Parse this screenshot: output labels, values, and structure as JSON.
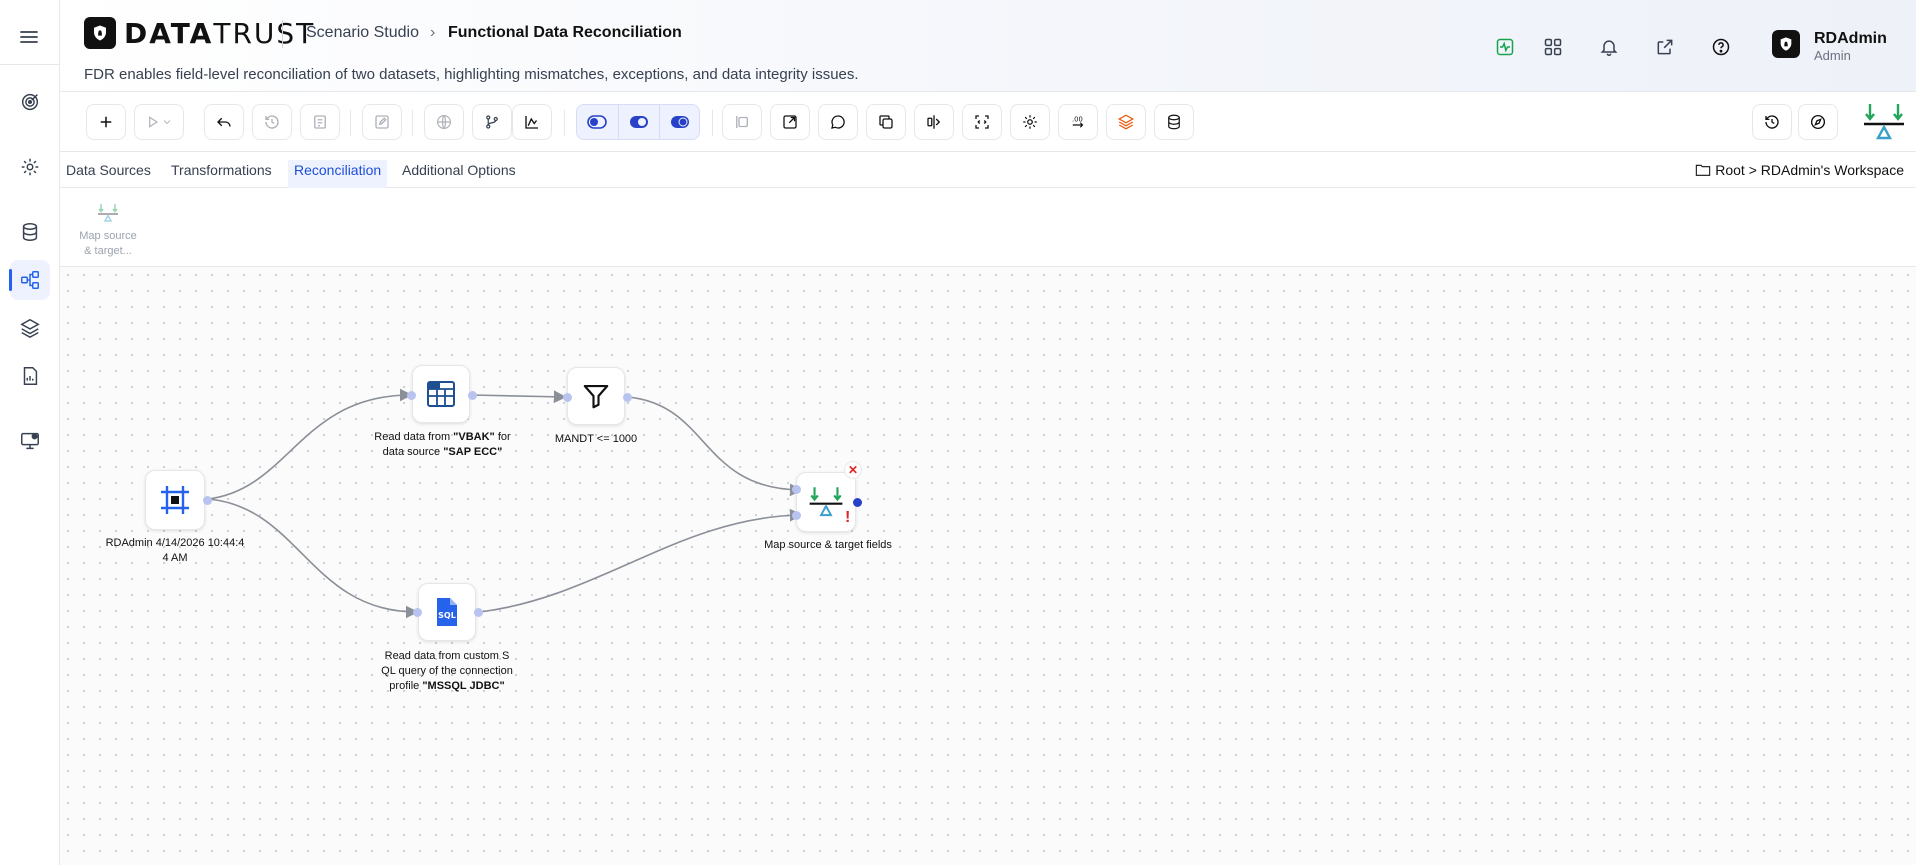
{
  "app": {
    "brand_bold": "DATA",
    "brand_rest": "TRUST",
    "breadcrumb": [
      "Scenario Studio",
      "Functional Data Reconciliation"
    ],
    "description": "FDR enables field-level reconciliation of two datasets, highlighting mismatches, exceptions, and data integrity issues."
  },
  "user": {
    "name": "RDAdmin",
    "role": "Admin"
  },
  "header_icons": [
    "activity-icon",
    "apps-grid-icon",
    "bell-icon",
    "external-link-icon",
    "help-icon"
  ],
  "sidebar": {
    "items": [
      {
        "icon": "target-icon",
        "active": false
      },
      {
        "icon": "gear-icon",
        "active": false
      },
      {
        "icon": "database-icon",
        "active": false
      },
      {
        "icon": "workflow-icon",
        "active": true
      },
      {
        "icon": "layers-icon",
        "active": false
      },
      {
        "icon": "report-icon",
        "active": false
      },
      {
        "icon": "monitor-settings-icon",
        "active": false
      }
    ]
  },
  "tabs": [
    {
      "label": "Data Sources",
      "active": false
    },
    {
      "label": "Transformations",
      "active": false
    },
    {
      "label": "Reconciliation",
      "active": true
    },
    {
      "label": "Additional Options",
      "active": false
    }
  ],
  "workspace_path": "Root > RDAdmin's Workspace",
  "palette": {
    "item_label_1": "Map source",
    "item_label_2": "& target..."
  },
  "nodes": {
    "start": {
      "label_1": "RDAdmin 4/14/2026 10:44:4",
      "label_2": "4 AM"
    },
    "sap": {
      "prefix": "Read data from ",
      "table": "\"VBAK\"",
      "mid": " for",
      "line2_prefix": "data source ",
      "source": "\"SAP ECC\""
    },
    "filter": {
      "label": "MANDT <= 1000"
    },
    "sql": {
      "line1": "Read data from custom S",
      "line2": "QL query of the connection",
      "line3_prefix": "profile ",
      "profile": "\"MSSQL JDBC\""
    },
    "map": {
      "label": "Map source & target fields",
      "warning": "!",
      "delete": "✕"
    }
  },
  "colors": {
    "accent": "#2563eb",
    "recon_green": "#22a55b",
    "recon_teal": "#3aa0c8",
    "error": "#dc2626"
  }
}
